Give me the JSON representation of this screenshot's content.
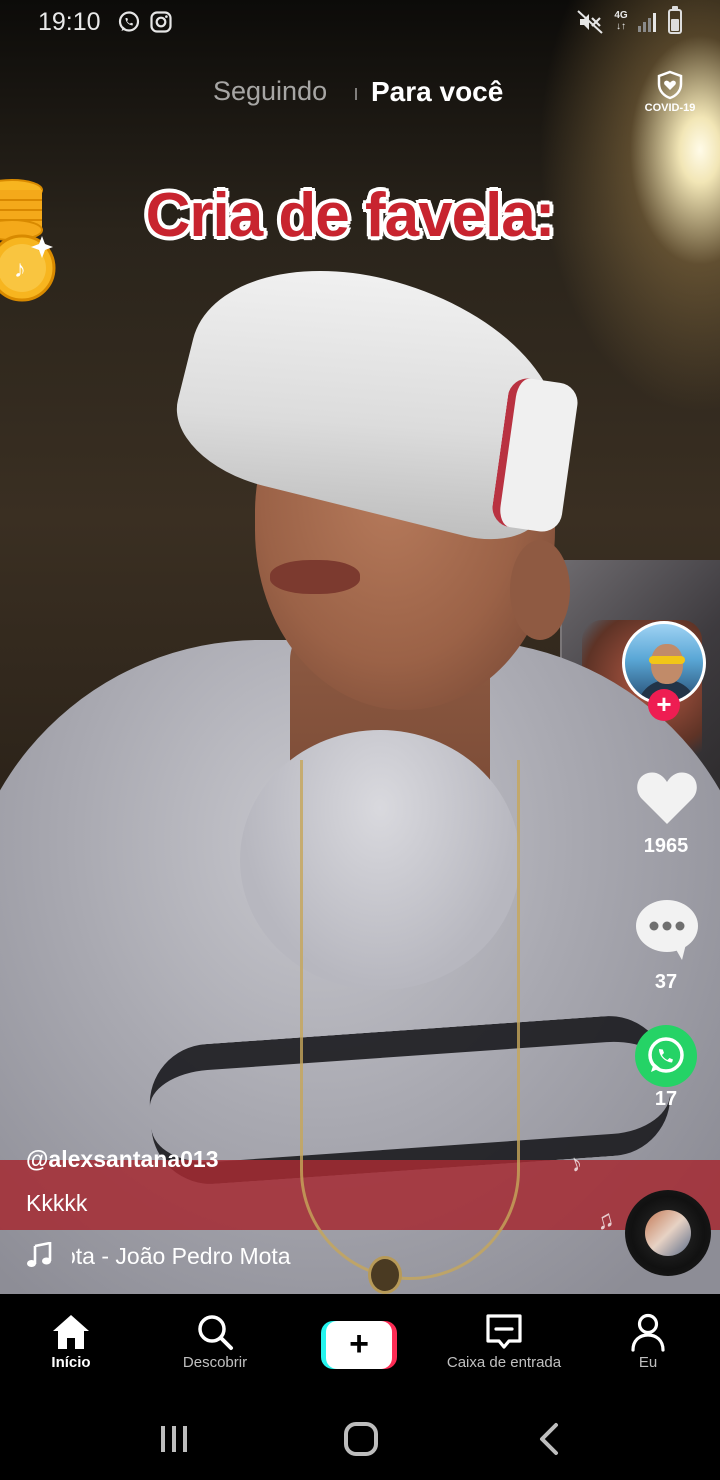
{
  "status_bar": {
    "time": "19:10",
    "network": "4G",
    "notification_icons": [
      "whatsapp-icon",
      "instagram-icon"
    ],
    "system_icons": [
      "mute-icon",
      "signal-icon",
      "battery-icon"
    ]
  },
  "feed_tabs": {
    "following": "Seguindo",
    "for_you": "Para você",
    "active": "for_you"
  },
  "covid": {
    "label": "COVID-19",
    "icon": "shield-heart-icon"
  },
  "video": {
    "overlay_text": "Cria de favela:"
  },
  "author": {
    "username": "@alexsantana013",
    "caption": "Kkkkk",
    "sound": "ota - João Pedro Mota",
    "follow_symbol": "+"
  },
  "actions": {
    "likes": "1965",
    "comments": "37",
    "shares": "17"
  },
  "bottom_nav": {
    "items": [
      {
        "label": "Início",
        "icon": "home-icon",
        "active": true
      },
      {
        "label": "Descobrir",
        "icon": "search-icon",
        "active": false
      },
      {
        "label": "",
        "icon": "plus-icon",
        "active": false
      },
      {
        "label": "Caixa de entrada",
        "icon": "inbox-icon",
        "active": false
      },
      {
        "label": "Eu",
        "icon": "profile-icon",
        "active": false
      }
    ],
    "create_symbol": "+"
  },
  "colors": {
    "overlay_text": "#c8242f",
    "follow_button": "#ee1d52",
    "whatsapp": "#25d366",
    "create_cyan": "#25f4ee",
    "create_red": "#fe2c55"
  }
}
